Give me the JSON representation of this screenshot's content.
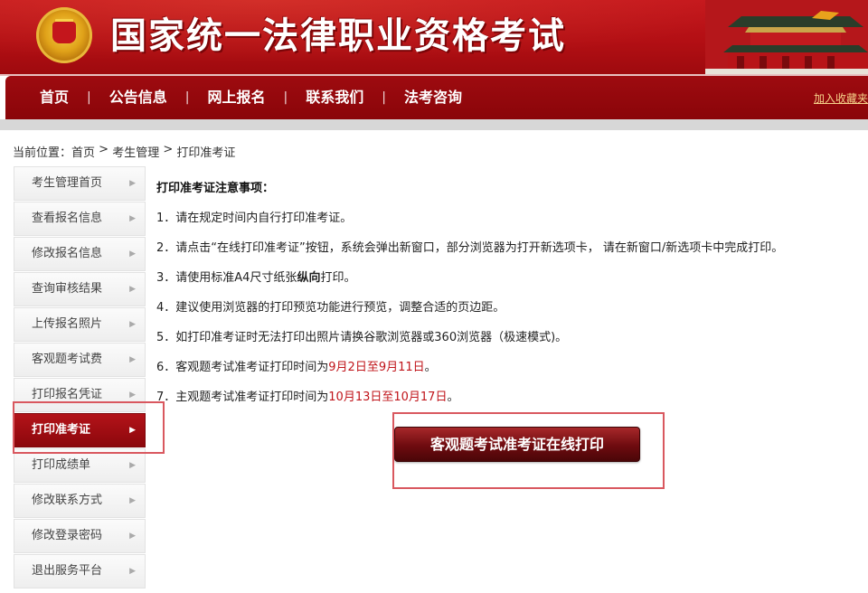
{
  "header": {
    "site_title": "国家统一法律职业资格考试",
    "emblem_icon": "national-emblem-icon",
    "tower_icon": "tiananmen-icon",
    "bg_color": "#b30f14"
  },
  "nav": {
    "items": [
      {
        "label": "首页"
      },
      {
        "label": "公告信息"
      },
      {
        "label": "网上报名"
      },
      {
        "label": "联系我们"
      },
      {
        "label": "法考咨询"
      }
    ],
    "separator": "|",
    "bookmark": "加入收藏夹"
  },
  "breadcrumb": {
    "prefix": "当前位置：",
    "items": [
      "首页",
      "考生管理",
      "打印准考证"
    ],
    "sep": " > "
  },
  "sidebar": {
    "items": [
      {
        "label": "考生管理首页"
      },
      {
        "label": "查看报名信息"
      },
      {
        "label": "修改报名信息"
      },
      {
        "label": "查询审核结果"
      },
      {
        "label": "上传报名照片"
      },
      {
        "label": "客观题考试费"
      },
      {
        "label": "打印报名凭证"
      },
      {
        "label": "打印准考证",
        "active": true
      },
      {
        "label": "打印成绩单"
      },
      {
        "label": "修改联系方式"
      },
      {
        "label": "修改登录密码"
      },
      {
        "label": "退出服务平台"
      }
    ],
    "arrow": "▶"
  },
  "content": {
    "title": "打印准考证注意事项：",
    "line1": "1．请在规定时间内自行打印准考证。",
    "line2": "2．请点击“在线打印准考证”按钮，系统会弹出新窗口，部分浏览器为打开新选项卡， 请在新窗口/新选项卡中完成打印。",
    "line3_pre": "3．请使用标准A4尺寸纸张",
    "line3_bold": "纵向",
    "line3_post": "打印。",
    "line4": "4．建议使用浏览器的打印预览功能进行预览，调整合适的页边距。",
    "line5": "5．如打印准考证时无法打印出照片请换谷歌浏览器或360浏览器（极速模式)。",
    "line6_pre": "6．客观题考试准考证打印时间为",
    "line6_red": "9月2日至9月11日",
    "line6_post": "。",
    "line7_pre": "7．主观题考试准考证打印时间为",
    "line7_red": "10月13日至10月17日",
    "line7_post": "。",
    "print_button": "客观题考试准考证在线打印",
    "highlight_color": "#d9585f",
    "red_text_color": "#c0141a"
  }
}
